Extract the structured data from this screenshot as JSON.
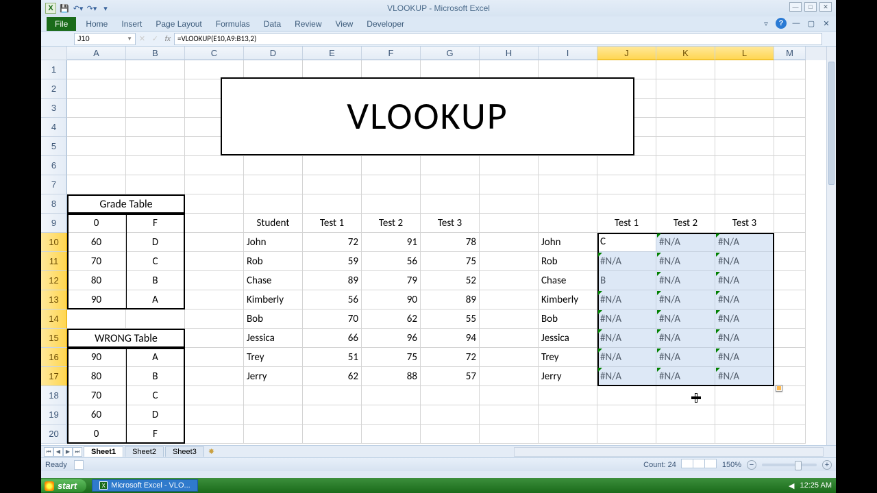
{
  "app": {
    "title": "VLOOKUP - Microsoft Excel"
  },
  "qat": {
    "excel": "X",
    "save": "💾",
    "undo": "↶▾",
    "redo": "↷▾",
    "custom": "▾"
  },
  "tabs": {
    "file": "File",
    "home": "Home",
    "insert": "Insert",
    "page_layout": "Page Layout",
    "formulas": "Formulas",
    "data": "Data",
    "review": "Review",
    "view": "View",
    "developer": "Developer"
  },
  "ribbon_right": {
    "min": "▿",
    "help": "?",
    "ch": "▢",
    "x": "✕"
  },
  "winctrl": {
    "min": "—",
    "max": "□",
    "close": "✕"
  },
  "name_box": "J10",
  "fx": {
    "cancel": "✕",
    "enter": "✓",
    "fx": "fx"
  },
  "formula": "=VLOOKUP(E10,A9:B13,2)",
  "cols": [
    "A",
    "B",
    "C",
    "D",
    "E",
    "F",
    "G",
    "H",
    "I",
    "J",
    "K",
    "L",
    "M"
  ],
  "row_numbers": [
    1,
    2,
    3,
    4,
    5,
    6,
    7,
    8,
    9,
    10,
    11,
    12,
    13,
    14,
    15,
    16,
    17,
    18,
    19,
    20
  ],
  "selected_cols": [
    "J",
    "K",
    "L"
  ],
  "selected_rows": [
    10,
    11,
    12,
    13,
    14,
    15,
    16,
    17
  ],
  "merged_title": "VLOOKUP",
  "grade_header": "Grade Table",
  "wrong_header": "WRONG Table",
  "grade_table": [
    [
      0,
      "F"
    ],
    [
      60,
      "D"
    ],
    [
      70,
      "C"
    ],
    [
      80,
      "B"
    ],
    [
      90,
      "A"
    ]
  ],
  "wrong_table": [
    [
      90,
      "A"
    ],
    [
      80,
      "B"
    ],
    [
      70,
      "C"
    ],
    [
      60,
      "D"
    ],
    [
      0,
      "F"
    ]
  ],
  "student_headers": [
    "Student",
    "Test 1",
    "Test 2",
    "Test 3"
  ],
  "students": [
    [
      "John",
      72,
      91,
      78
    ],
    [
      "Rob",
      59,
      56,
      75
    ],
    [
      "Chase",
      89,
      79,
      52
    ],
    [
      "Kimberly",
      56,
      90,
      89
    ],
    [
      "Bob",
      70,
      62,
      55
    ],
    [
      "Jessica",
      66,
      96,
      94
    ],
    [
      "Trey",
      51,
      75,
      72
    ],
    [
      "Jerry",
      62,
      88,
      57
    ]
  ],
  "result_headers_col_i_blank": "",
  "result_names": [
    "John",
    "Rob",
    "Chase",
    "Kimberly",
    "Bob",
    "Jessica",
    "Trey",
    "Jerry"
  ],
  "result_headers": [
    "Test 1",
    "Test 2",
    "Test 3"
  ],
  "results": [
    [
      "C",
      "#N/A",
      "#N/A"
    ],
    [
      "#N/A",
      "#N/A",
      "#N/A"
    ],
    [
      "B",
      "#N/A",
      "#N/A"
    ],
    [
      "#N/A",
      "#N/A",
      "#N/A"
    ],
    [
      "#N/A",
      "#N/A",
      "#N/A"
    ],
    [
      "#N/A",
      "#N/A",
      "#N/A"
    ],
    [
      "#N/A",
      "#N/A",
      "#N/A"
    ],
    [
      "#N/A",
      "#N/A",
      "#N/A"
    ]
  ],
  "sheets": {
    "s1": "Sheet1",
    "s2": "Sheet2",
    "s3": "Sheet3"
  },
  "status": {
    "ready": "Ready",
    "count": "Count: 24",
    "zoom": "150%"
  },
  "taskbar": {
    "start": "start",
    "item": "Microsoft Excel - VLO...",
    "time": "12:25 AM"
  },
  "colw": {
    "rh": 38,
    "A": 86,
    "B": 86,
    "C": 86,
    "D": 86,
    "E": 86,
    "F": 86,
    "G": 86,
    "H": 86,
    "I": 86,
    "J": 86,
    "K": 86,
    "L": 86,
    "M": 46
  }
}
